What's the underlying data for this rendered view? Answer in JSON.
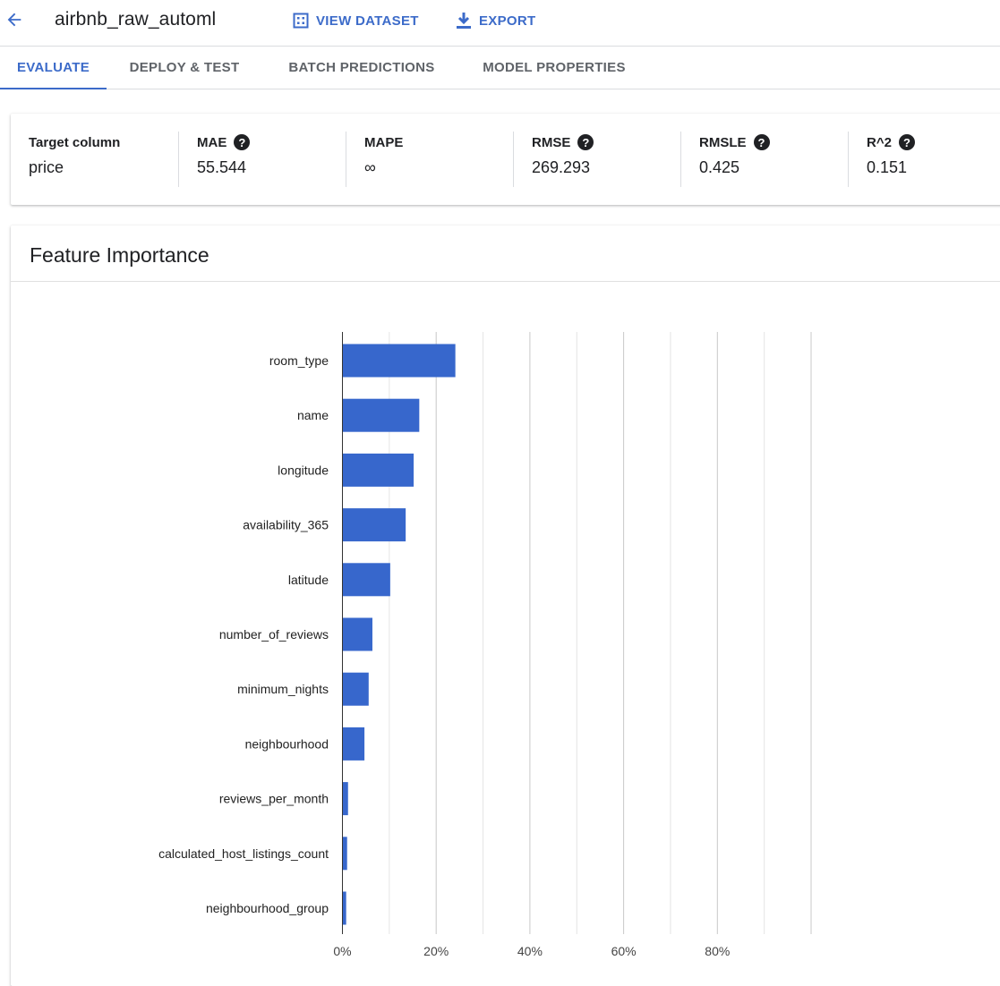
{
  "header": {
    "back_icon": "arrow-back-icon",
    "title": "airbnb_raw_automl",
    "view_dataset_label": "VIEW DATASET",
    "view_dataset_icon": "grid-icon",
    "export_label": "EXPORT",
    "export_icon": "download-icon",
    "accent_color": "#3c6bc9"
  },
  "tabs": [
    {
      "label": "EVALUATE",
      "active": true
    },
    {
      "label": "DEPLOY & TEST",
      "active": false
    },
    {
      "label": "BATCH PREDICTIONS",
      "active": false
    },
    {
      "label": "MODEL PROPERTIES",
      "active": false
    }
  ],
  "metrics": [
    {
      "label": "Target column",
      "value": "price",
      "help": false
    },
    {
      "label": "MAE",
      "value": "55.544",
      "help": true
    },
    {
      "label": "MAPE",
      "value": "∞",
      "help": false
    },
    {
      "label": "RMSE",
      "value": "269.293",
      "help": true
    },
    {
      "label": "RMSLE",
      "value": "0.425",
      "help": true
    },
    {
      "label": "R^2",
      "value": "0.151",
      "help": true
    }
  ],
  "help_icon_glyph": "?",
  "feature_importance": {
    "title": "Feature Importance"
  },
  "chart_data": {
    "type": "bar",
    "orientation": "horizontal",
    "title": "Feature Importance",
    "categories": [
      "room_type",
      "name",
      "longitude",
      "availability_365",
      "latitude",
      "number_of_reviews",
      "minimum_nights",
      "neighbourhood",
      "reviews_per_month",
      "calculated_host_listings_count",
      "neighbourhood_group"
    ],
    "values": [
      24,
      16.3,
      15.1,
      13.4,
      10.1,
      6.3,
      5.5,
      4.6,
      1.1,
      0.9,
      0.7
    ],
    "value_unit": "%",
    "xlim": [
      0,
      100
    ],
    "xticks": [
      0,
      20,
      40,
      60,
      80
    ],
    "xtick_labels": [
      "0%",
      "20%",
      "40%",
      "60%",
      "80%"
    ],
    "grid": true,
    "bar_color": "#3767cc"
  }
}
